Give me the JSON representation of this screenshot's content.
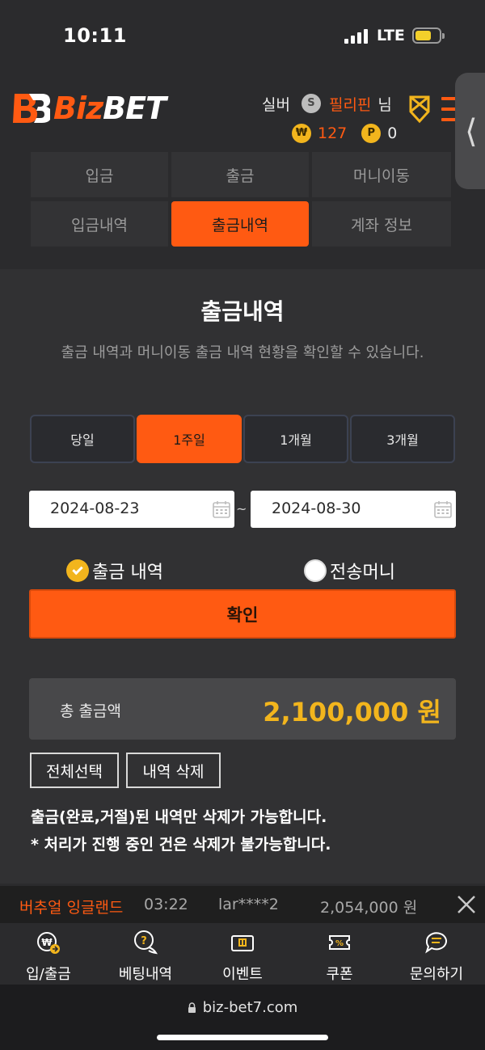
{
  "status_bar": {
    "time": "10:11",
    "network": "LTE"
  },
  "brand": {
    "logo_biz": "Biz",
    "logo_bet": "BET",
    "accent": "#ff5a12"
  },
  "user": {
    "rank": "실버",
    "rank_badge": "S",
    "name": "필리핀",
    "suffix": "님",
    "money_badge": "₩",
    "money": "127",
    "point_badge": "P",
    "points": "0"
  },
  "tabs": [
    {
      "label": "입금"
    },
    {
      "label": "출금"
    },
    {
      "label": "머니이동"
    },
    {
      "label": "입금내역"
    },
    {
      "label": "출금내역",
      "active": true
    },
    {
      "label": "계좌 정보"
    }
  ],
  "page": {
    "title": "출금내역",
    "description": "출금 내역과 머니이동 출금 내역 현황을 확인할 수 있습니다."
  },
  "periods": [
    {
      "label": "당일"
    },
    {
      "label": "1주일",
      "active": true
    },
    {
      "label": "1개월"
    },
    {
      "label": "3개월"
    }
  ],
  "date_range": {
    "from": "2024-08-23",
    "separator": "~",
    "to": "2024-08-30"
  },
  "options": [
    {
      "label": "출금 내역",
      "selected": true
    },
    {
      "label": "전송머니",
      "selected": false
    }
  ],
  "confirm_label": "확인",
  "total": {
    "label": "총 출금액",
    "value": "2,100,000 원"
  },
  "actions": {
    "select_all": "전체선택",
    "delete": "내역 삭제"
  },
  "notices": [
    "출금(완료,거절)된 내역만 삭제가 가능합니다.",
    "* 처리가 진행 중인 건은 삭제가 불가능합니다."
  ],
  "ticker": {
    "game": "버추얼 잉글랜드",
    "time": "03:22",
    "user": "lar****2",
    "amount": "2,054,000 원"
  },
  "bottom_nav": [
    {
      "label": "입/출금",
      "icon": "deposit-withdraw-icon"
    },
    {
      "label": "베팅내역",
      "icon": "betting-history-icon"
    },
    {
      "label": "이벤트",
      "icon": "event-icon"
    },
    {
      "label": "쿠폰",
      "icon": "coupon-icon"
    },
    {
      "label": "문의하기",
      "icon": "inquiry-icon"
    }
  ],
  "browser": {
    "url": "biz-bet7.com"
  }
}
